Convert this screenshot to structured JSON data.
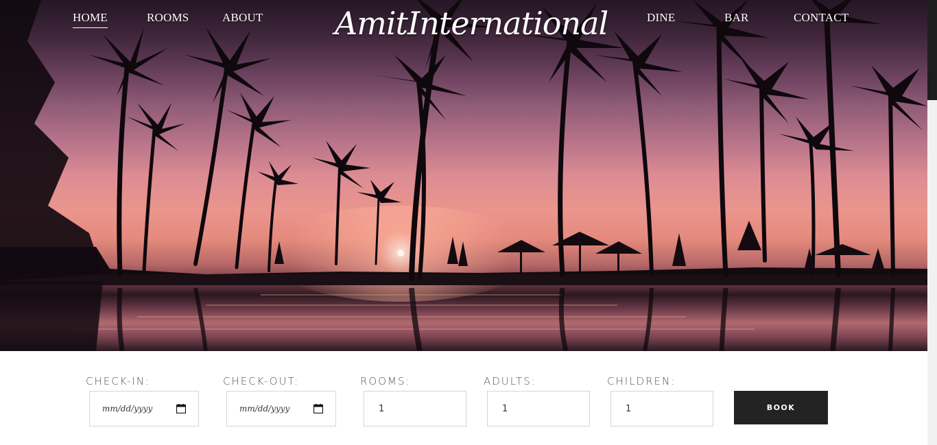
{
  "nav": {
    "left": [
      "HOME",
      "ROOMS",
      "ABOUT"
    ],
    "right": [
      "DINE",
      "BAR",
      "CONTACT"
    ],
    "active": "HOME"
  },
  "brand": "AmitInternational",
  "booking": {
    "checkin": {
      "label": "CHECK-IN:",
      "placeholder": "mm/dd/yyyy"
    },
    "checkout": {
      "label": "CHECK-OUT:",
      "placeholder": "mm/dd/yyyy"
    },
    "rooms": {
      "label": "ROOMS:",
      "value": "1"
    },
    "adults": {
      "label": "ADULTS:",
      "value": "1"
    },
    "children": {
      "label": "CHILDREN:",
      "value": "1"
    },
    "book_label": "BOOK"
  },
  "icons": {
    "date": "calendar-icon"
  },
  "colors": {
    "button": "#232323",
    "nav_text": "#ffffff",
    "label_text": "#555555"
  }
}
